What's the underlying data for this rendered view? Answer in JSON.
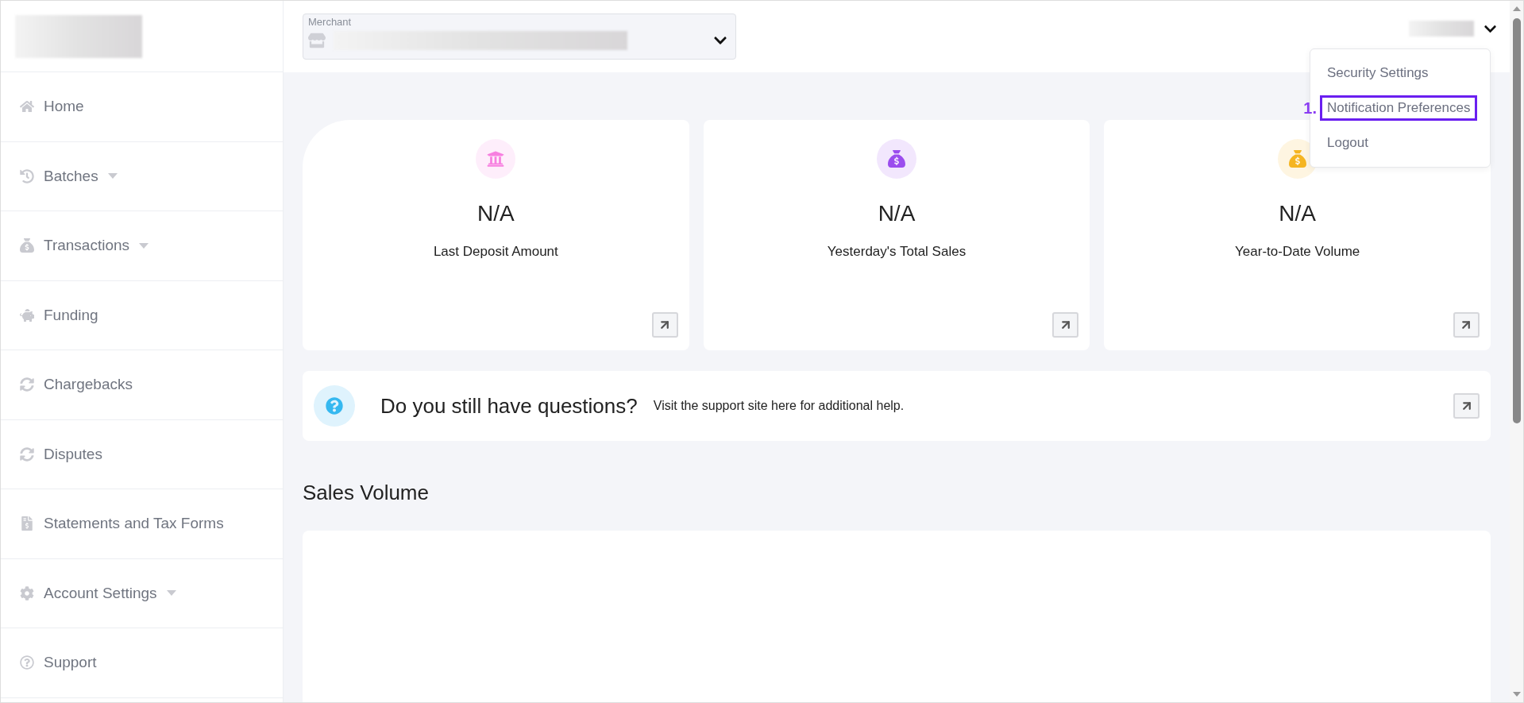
{
  "header": {
    "merchant_field": {
      "label": "Merchant"
    }
  },
  "sidebar": {
    "items": [
      {
        "label": "Home",
        "has_dropdown": false
      },
      {
        "label": "Batches",
        "has_dropdown": true
      },
      {
        "label": "Transactions",
        "has_dropdown": true
      },
      {
        "label": "Funding",
        "has_dropdown": false
      },
      {
        "label": "Chargebacks",
        "has_dropdown": false
      },
      {
        "label": "Disputes",
        "has_dropdown": false
      },
      {
        "label": "Statements and Tax Forms",
        "has_dropdown": false
      },
      {
        "label": "Account Settings",
        "has_dropdown": true
      },
      {
        "label": "Support",
        "has_dropdown": false
      }
    ]
  },
  "user_menu": {
    "items": [
      {
        "label": "Security Settings",
        "highlighted": false
      },
      {
        "label": "Notification Preferences",
        "highlighted": true,
        "marker": "1."
      },
      {
        "label": "Logout",
        "highlighted": false
      }
    ]
  },
  "stat_cards": [
    {
      "value": "N/A",
      "label": "Last Deposit Amount",
      "color": "#f77fe0"
    },
    {
      "value": "N/A",
      "label": "Yesterday's Total Sales",
      "color": "#9b4dee"
    },
    {
      "value": "N/A",
      "label": "Year-to-Date Volume",
      "color": "#f5b521"
    }
  ],
  "support_banner": {
    "title": "Do you still have questions?",
    "text": "Visit the support site here for additional help."
  },
  "sales_volume": {
    "title": "Sales Volume"
  }
}
